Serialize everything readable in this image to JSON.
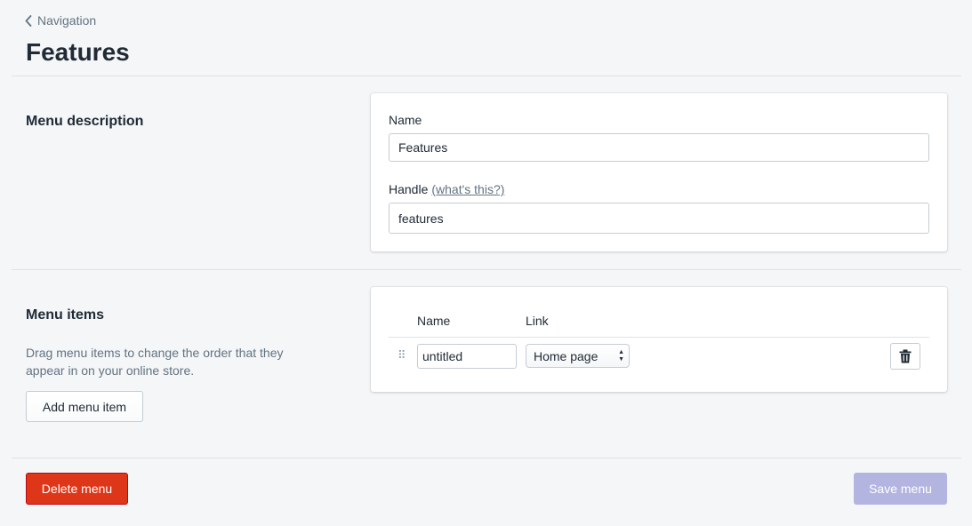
{
  "breadcrumb": {
    "label": "Navigation"
  },
  "page": {
    "title": "Features"
  },
  "menu_description": {
    "title": "Menu description",
    "name_label": "Name",
    "name_value": "Features",
    "handle_label": "Handle",
    "handle_help": "(what's this?)",
    "handle_value": "features"
  },
  "menu_items": {
    "title": "Menu items",
    "description": "Drag menu items to change the order that they appear in on your online store.",
    "add_button": "Add menu item",
    "columns": {
      "name": "Name",
      "link": "Link"
    },
    "items": [
      {
        "name": "untitled",
        "link": "Home page"
      }
    ],
    "drag_glyph": "⠿"
  },
  "footer": {
    "delete_button": "Delete menu",
    "save_button": "Save menu"
  },
  "colors": {
    "danger": "#de3618",
    "primary_disabled": "#b3b5e0",
    "background": "#f4f6f8"
  }
}
